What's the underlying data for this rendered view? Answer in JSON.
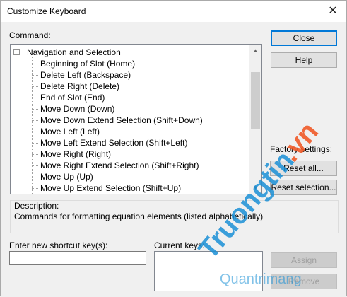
{
  "window": {
    "title": "Customize Keyboard"
  },
  "command_label": "Command:",
  "tree": {
    "root": "Navigation and Selection",
    "items": [
      "Beginning of Slot (Home)",
      "Delete Left (Backspace)",
      "Delete Right (Delete)",
      "End of Slot (End)",
      "Move Down (Down)",
      "Move Down Extend Selection (Shift+Down)",
      "Move Left (Left)",
      "Move Left Extend Selection (Shift+Left)",
      "Move Right (Right)",
      "Move Right Extend Selection (Shift+Right)",
      "Move Up (Up)",
      "Move Up Extend Selection (Shift+Up)"
    ]
  },
  "buttons": {
    "close": "Close",
    "help": "Help",
    "reset_all": "Reset all...",
    "reset_selection": "Reset selection...",
    "assign": "Assign",
    "remove": "Remove"
  },
  "factory_settings_label": "Factory settings:",
  "description": {
    "label": "Description:",
    "text": "Commands for formatting equation elements  (listed alphabetically)"
  },
  "shortcut": {
    "label": "Enter new shortcut key(s):",
    "value": ""
  },
  "current_keys_label": "Current keys:",
  "watermark": {
    "text": "Truongtin",
    "tld": ".vn",
    "sub": "Quantrimang"
  },
  "colors": {
    "accent": "#0078d7",
    "watermark_blue": "#1a8fd6",
    "watermark_orange": "#f05a28"
  }
}
